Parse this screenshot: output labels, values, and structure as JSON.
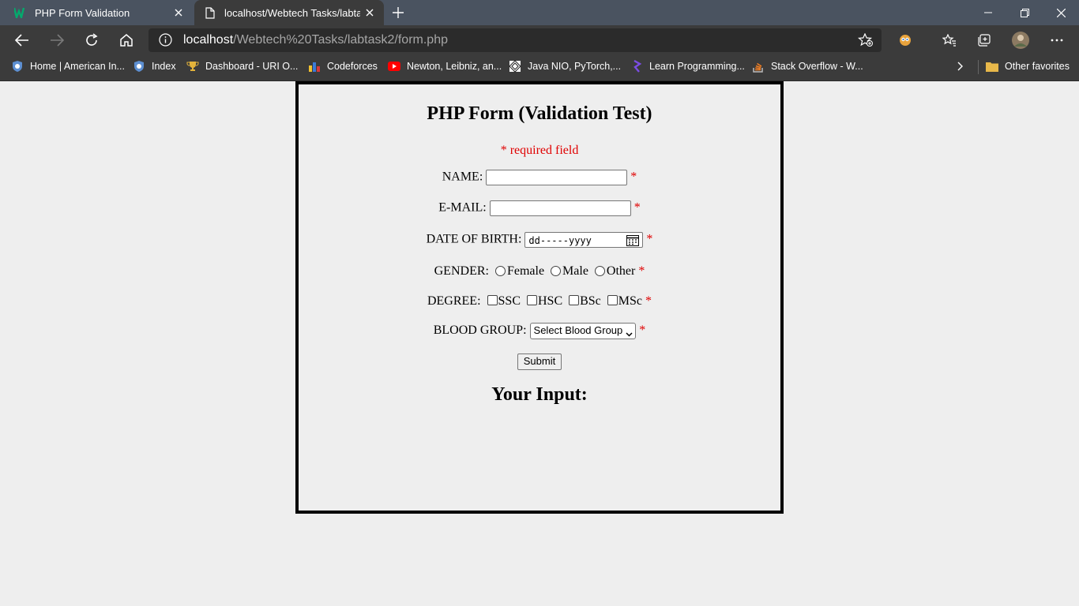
{
  "browser": {
    "tabs": [
      {
        "label": "PHP Form Validation",
        "active": false
      },
      {
        "label": "localhost/Webtech Tasks/labtask2/form.php",
        "active": true
      }
    ],
    "address": {
      "host": "localhost",
      "path": "/Webtech%20Tasks/labtask2/form.php"
    },
    "bookmarks": [
      {
        "label": "Home | American In...",
        "icon": "shield-globe-icon"
      },
      {
        "label": "Index",
        "icon": "shield-globe-icon"
      },
      {
        "label": "Dashboard - URI O...",
        "icon": "trophy-icon"
      },
      {
        "label": "Codeforces",
        "icon": "bar-chart-icon"
      },
      {
        "label": "Newton, Leibniz, an...",
        "icon": "youtube-icon"
      },
      {
        "label": "Java NIO, PyTorch,...",
        "icon": "geometric-icon"
      },
      {
        "label": "Learn Programming...",
        "icon": "code-logo-icon"
      },
      {
        "label": "Stack Overflow - W...",
        "icon": "stackoverflow-icon"
      }
    ],
    "other_favorites": "Other favorites"
  },
  "form": {
    "title": "PHP Form (Validation Test)",
    "required_note": "* required field",
    "asterisk": "*",
    "name_label": "NAME:",
    "email_label": "E-MAIL:",
    "dob_label": "DATE OF BIRTH:",
    "dob_placeholder": "dd-----yyyy",
    "gender_label": "GENDER:",
    "gender_options": [
      "Female",
      "Male",
      "Other"
    ],
    "degree_label": "DEGREE:",
    "degree_options": [
      "SSC",
      "HSC",
      "BSc",
      "MSc"
    ],
    "blood_label": "BLOOD GROUP:",
    "blood_selected": "Select Blood Group",
    "submit_label": "Submit",
    "your_input_heading": "Your Input:"
  },
  "colors": {
    "required": "#e00000",
    "tabstrip": "#4a5360",
    "toolbar": "#3b3b3b"
  }
}
